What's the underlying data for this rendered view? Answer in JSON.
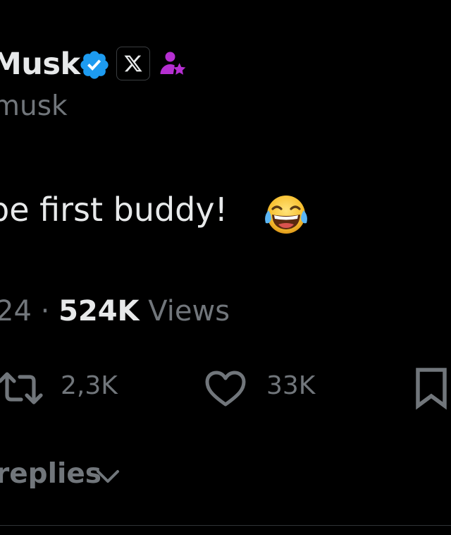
{
  "header": {
    "display_name": "Musk",
    "handle": "musk",
    "verified_icon": "verified-badge-icon",
    "affiliate_icon": "x-logo-icon",
    "subscriber_icon": "subscriber-star-icon"
  },
  "post": {
    "text": "be first buddy!",
    "emoji": "face-with-tears-of-joy"
  },
  "meta": {
    "date_fragment": "24",
    "separator": "·",
    "views_count": "524K",
    "views_label": "Views"
  },
  "actions": {
    "retweet_count": "2,3K",
    "like_count": "33K"
  },
  "replies": {
    "label": "replies"
  },
  "colors": {
    "background": "#000000",
    "primary_text": "#e7e9ea",
    "secondary_text": "#71767b",
    "verified_blue": "#1d9bf0",
    "subscriber_purple": "#b52fd1",
    "divider": "#2f3336"
  }
}
